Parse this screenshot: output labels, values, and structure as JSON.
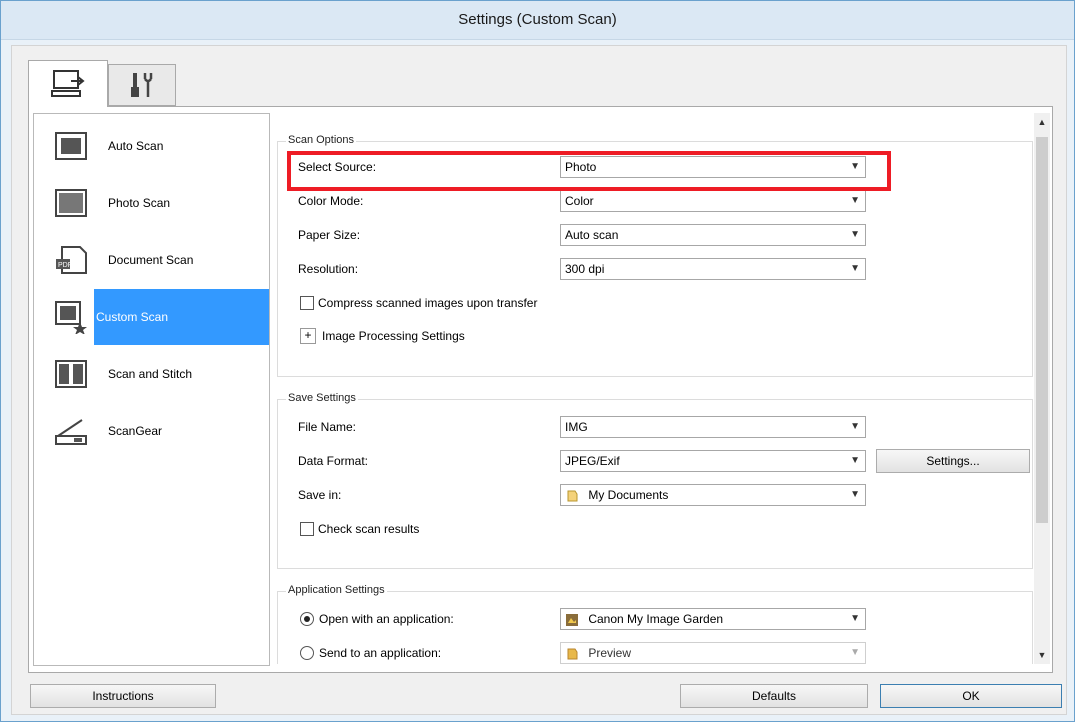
{
  "window": {
    "title": "Settings (Custom Scan)"
  },
  "tabs": [
    {
      "icon": "scan-from-computer-icon"
    },
    {
      "icon": "general-settings-icon"
    }
  ],
  "sidebar": {
    "items": [
      {
        "label": "Auto Scan",
        "icon": "auto-scan-icon",
        "selected": false
      },
      {
        "label": "Photo Scan",
        "icon": "photo-scan-icon",
        "selected": false
      },
      {
        "label": "Document Scan",
        "icon": "document-scan-icon",
        "selected": false
      },
      {
        "label": "Custom Scan",
        "icon": "custom-scan-icon",
        "selected": true
      },
      {
        "label": "Scan and Stitch",
        "icon": "scan-and-stitch-icon",
        "selected": false
      },
      {
        "label": "ScanGear",
        "icon": "scangear-icon",
        "selected": false
      }
    ]
  },
  "scan_options": {
    "title": "Scan Options",
    "select_source_label": "Select Source:",
    "select_source_value": "Photo",
    "color_mode_label": "Color Mode:",
    "color_mode_value": "Color",
    "paper_size_label": "Paper Size:",
    "paper_size_value": "Auto scan",
    "resolution_label": "Resolution:",
    "resolution_value": "300 dpi",
    "compress_label": "Compress scanned images upon transfer",
    "compress_checked": false,
    "image_processing_label": "Image Processing Settings",
    "expand_symbol": "+"
  },
  "save_settings": {
    "title": "Save Settings",
    "file_name_label": "File Name:",
    "file_name_value": "IMG",
    "data_format_label": "Data Format:",
    "data_format_value": "JPEG/Exif",
    "settings_button": "Settings...",
    "save_in_label": "Save in:",
    "save_in_value": "My Documents",
    "check_results_label": "Check scan results",
    "check_results_checked": false
  },
  "application_settings": {
    "title": "Application Settings",
    "open_with_label": "Open with an application:",
    "open_with_value": "Canon My Image Garden",
    "open_with_selected": true,
    "send_to_label": "Send to an application:",
    "send_to_value": "Preview",
    "send_to_selected": false
  },
  "footer": {
    "instructions_button": "Instructions",
    "defaults_button": "Defaults",
    "ok_button": "OK"
  },
  "colors": {
    "selection": "#3399ff",
    "highlight": "#ee1c25",
    "title_bar": "#dbe8f4"
  }
}
